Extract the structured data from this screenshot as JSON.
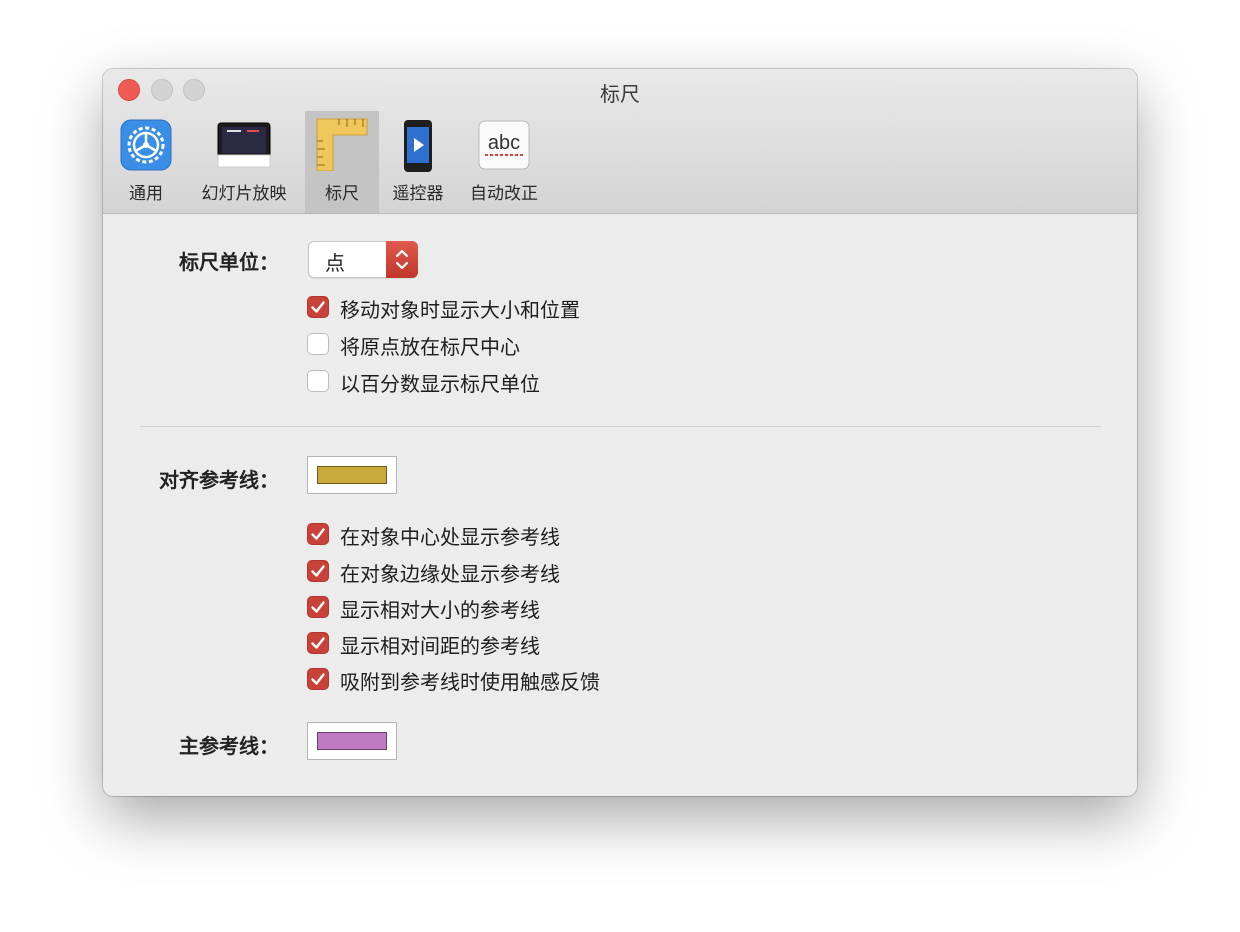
{
  "window": {
    "title": "标尺"
  },
  "toolbar": {
    "tabs": [
      {
        "id": "general",
        "label": "通用",
        "icon": "gear-icon"
      },
      {
        "id": "slideshow",
        "label": "幻灯片放映",
        "icon": "slideshow-icon"
      },
      {
        "id": "rulers",
        "label": "标尺",
        "icon": "ruler-icon",
        "selected": true
      },
      {
        "id": "remotes",
        "label": "遥控器",
        "icon": "remote-icon"
      },
      {
        "id": "autocorrect",
        "label": "自动改正",
        "icon": "abc-spellcheck-icon"
      }
    ],
    "autocorrect_icon_text": "abc"
  },
  "ruler_units": {
    "label": "标尺单位：",
    "value": "点"
  },
  "ruler_options": [
    {
      "label": "移动对象时显示大小和位置",
      "checked": true
    },
    {
      "label": "将原点放在标尺中心",
      "checked": false
    },
    {
      "label": "以百分数显示标尺单位",
      "checked": false
    }
  ],
  "alignment_guides": {
    "label": "对齐参考线：",
    "color": "#c9a93a"
  },
  "guide_options": [
    {
      "label": "在对象中心处显示参考线",
      "checked": true
    },
    {
      "label": "在对象边缘处显示参考线",
      "checked": true
    },
    {
      "label": "显示相对大小的参考线",
      "checked": true
    },
    {
      "label": "显示相对间距的参考线",
      "checked": true
    },
    {
      "label": "吸附到参考线时使用触感反馈",
      "checked": true
    }
  ],
  "master_guides": {
    "label": "主参考线：",
    "color": "#c07ac4"
  },
  "colors": {
    "accent": "#c9423a",
    "close_button": "#ee5b52"
  }
}
